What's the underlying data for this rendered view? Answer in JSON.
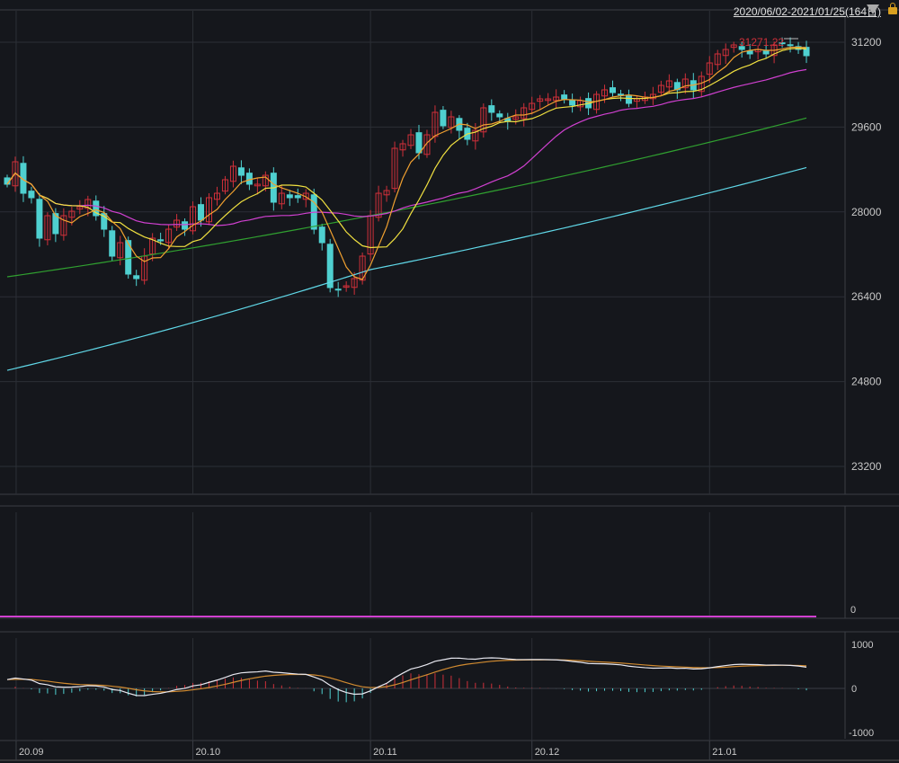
{
  "header": {
    "date_range": "2020/06/02-2021/01/25(164日)"
  },
  "chart_data": {
    "type": "candlestick",
    "price_axis": {
      "ticks": [
        31200,
        29600,
        28000,
        26400,
        24800,
        23200
      ]
    },
    "volume_axis": {
      "ticks": [
        "0"
      ]
    },
    "macd_axis": {
      "ticks": [
        1000,
        0,
        -1000
      ],
      "tick_labels": [
        "1000",
        "0",
        "-1000"
      ]
    },
    "x_labels": [
      {
        "label": "20.09",
        "index": 2
      },
      {
        "label": "20.10",
        "index": 23
      },
      {
        "label": "20.11",
        "index": 45
      },
      {
        "label": "20.12",
        "index": 65
      },
      {
        "label": "21.01",
        "index": 87
      }
    ],
    "max_annotation": "31271.22",
    "closes": [
      28522,
      28946,
      28352,
      28268,
      27505,
      27929,
      27590,
      27929,
      28013,
      28098,
      28234,
      27929,
      27674,
      27166,
      27420,
      26827,
      26742,
      27166,
      27505,
      27454,
      27674,
      27844,
      27674,
      28098,
      27844,
      28268,
      28352,
      28607,
      28861,
      28691,
      28522,
      28522,
      28691,
      28183,
      28352,
      28268,
      28268,
      28352,
      27674,
      27420,
      26573,
      26539,
      26607,
      26742,
      27166,
      27929,
      28352,
      28403,
      29200,
      29285,
      29454,
      29115,
      29454,
      29878,
      29624,
      29793,
      29539,
      29369,
      29539,
      29963,
      29878,
      29793,
      29708,
      29793,
      29963,
      30047,
      30132,
      30132,
      30166,
      30132,
      30013,
      30098,
      29963,
      30217,
      30302,
      30251,
      30217,
      30047,
      30132,
      30166,
      30217,
      30386,
      30471,
      30302,
      30505,
      30302,
      30556,
      30810,
      30980,
      31064,
      31149,
      31064,
      30980,
      31064,
      30980,
      31149,
      31183,
      31149,
      31064,
      30946
    ],
    "ma75": [
      {
        "index": 0,
        "value": 26776
      },
      {
        "index": 45,
        "value": 27929
      },
      {
        "index": 100,
        "value": 29810
      }
    ],
    "ma200": [
      {
        "index": 0,
        "value": 25013
      },
      {
        "index": 45,
        "value": 26912
      },
      {
        "index": 100,
        "value": 28878
      }
    ],
    "colors": {
      "up": "#d0303a",
      "down": "#4fd0d0",
      "ma5": "#f0a030",
      "ma10": "#f0e040",
      "ma25": "#d040d0",
      "ma75": "#30a030",
      "ma200": "#60d8e8",
      "macd": "#e8e8f0",
      "signal": "#d08a30"
    }
  }
}
